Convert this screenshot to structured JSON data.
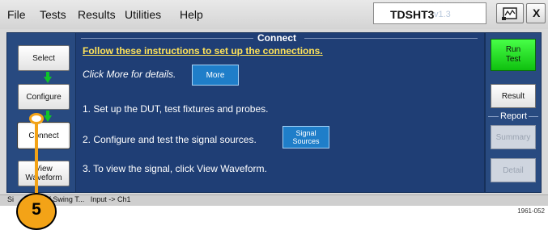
{
  "menubar": {
    "items": [
      "File",
      "Tests",
      "Results",
      "Utilities",
      "Help"
    ],
    "product_name": "TDSHT3",
    "product_version": "v1.3",
    "close_label": "X"
  },
  "left_nav": {
    "select": "Select",
    "configure": "Configure",
    "connect": "Connect",
    "view_waveform_line1": "View",
    "view_waveform_line2": "Waveform"
  },
  "main": {
    "panel_title": "Connect",
    "instructions_title": "Follow these instructions to set up the connections.",
    "click_more": "Click More for details.",
    "more_button": "More",
    "step1": "1. Set up the DUT, test fixtures and probes.",
    "step2": "2. Configure and test the signal sources.",
    "signal_sources_line1": "Signal",
    "signal_sources_line2": "Sources",
    "step3": "3. To view the signal, click View Waveform."
  },
  "right_col": {
    "run_line1": "Run",
    "run_line2": "Test",
    "result": "Result",
    "report_label": "Report",
    "summary": "Summary",
    "detail": "Detail"
  },
  "statusbar": {
    "text": "Si     Max-Diff Swing T...   Input -> Ch1"
  },
  "callout": {
    "number": "5"
  },
  "figure_id": "1961-052",
  "colors": {
    "panel_blue": "#1f3e75",
    "accent_green": "#0fc42a",
    "callout_orange": "#f3a317",
    "title_yellow": "#ffe35a"
  }
}
